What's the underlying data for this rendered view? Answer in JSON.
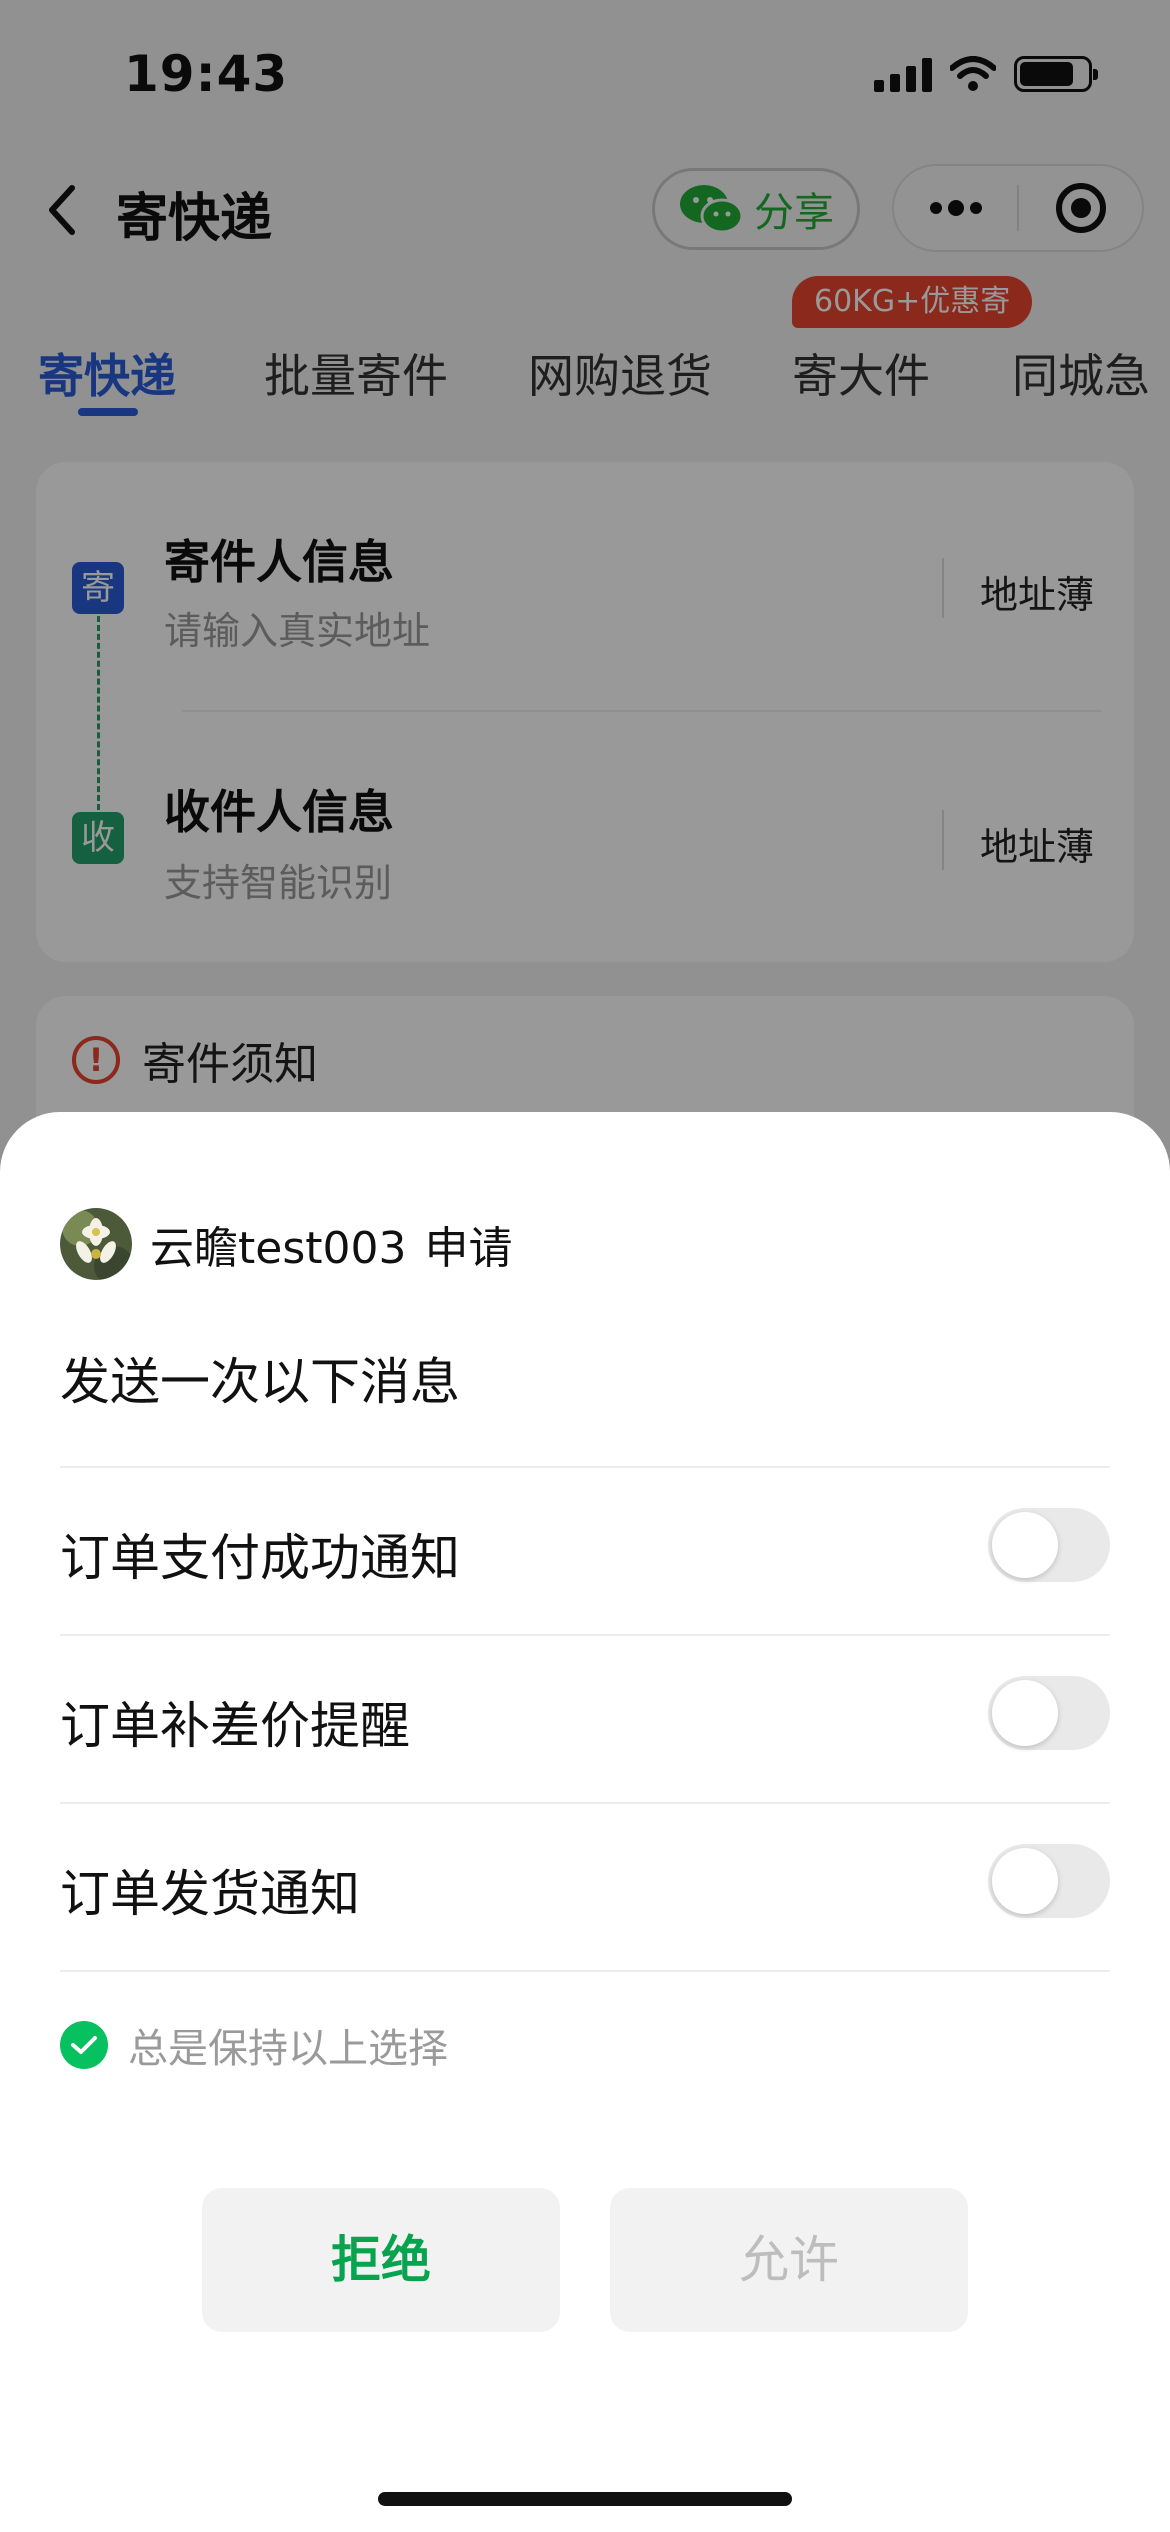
{
  "status_bar": {
    "time": "19:43"
  },
  "nav": {
    "title": "寄快递",
    "share_label": "分享"
  },
  "promo_badge": "60KG+优惠寄",
  "tabs": [
    {
      "label": "寄快递",
      "active": true
    },
    {
      "label": "批量寄件"
    },
    {
      "label": "网购退货"
    },
    {
      "label": "寄大件"
    },
    {
      "label": "同城急"
    }
  ],
  "address_card": {
    "sender": {
      "badge": "寄",
      "title": "寄件人信息",
      "subtitle": "请输入真实地址",
      "book_label": "地址薄"
    },
    "receiver": {
      "badge": "收",
      "title": "收件人信息",
      "subtitle": "支持智能识别",
      "book_label": "地址薄"
    }
  },
  "notice": {
    "title": "寄件须知"
  },
  "sheet": {
    "requester_name": "云瞻test003",
    "requester_action": "申请",
    "title": "发送一次以下消息",
    "options": [
      {
        "label": "订单支付成功通知",
        "enabled": false
      },
      {
        "label": "订单补差价提醒",
        "enabled": false
      },
      {
        "label": "订单发货通知",
        "enabled": false
      }
    ],
    "keep_choice_label": "总是保持以上选择",
    "keep_choice_checked": true,
    "reject_label": "拒绝",
    "allow_label": "允许"
  },
  "colors": {
    "accent_blue": "#2a5bd7",
    "wechat_green": "#07c160",
    "promo_red": "#e8452f"
  }
}
